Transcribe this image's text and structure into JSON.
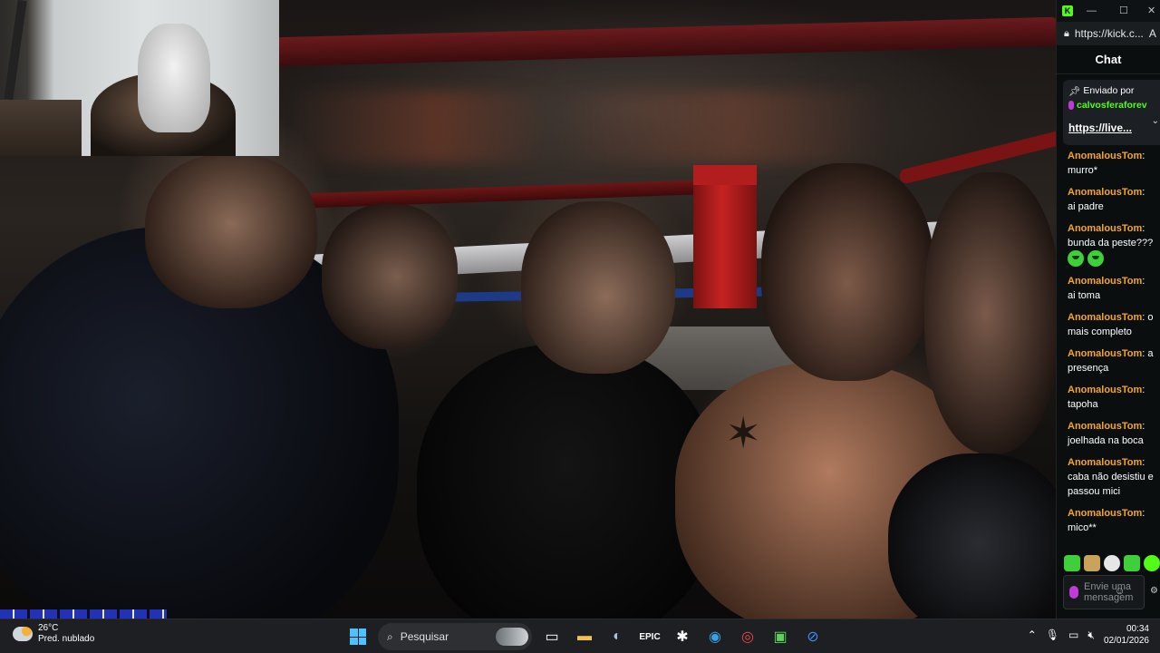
{
  "browser": {
    "url": "https://kick.c...",
    "url_suffix": "A"
  },
  "chat": {
    "title": "Chat",
    "pinned": {
      "label": "Enviado por",
      "user": "calvosferaforev",
      "link": "https://live..."
    },
    "messages": [
      {
        "user": "AnomalousTom",
        "text": "murro*"
      },
      {
        "user": "AnomalousTom",
        "text": "ai padre"
      },
      {
        "user": "AnomalousTom",
        "text": "bunda da peste???"
      },
      {
        "user": "AnomalousTom",
        "text": "ai toma"
      },
      {
        "user": "AnomalousTom",
        "text": "o mais completo"
      },
      {
        "user": "AnomalousTom",
        "text": "a presença"
      },
      {
        "user": "AnomalousTom",
        "text": "tapoha"
      },
      {
        "user": "AnomalousTom",
        "text": "joelhada na boca"
      },
      {
        "user": "AnomalousTom",
        "text": "caba não desistiu e passou mici"
      },
      {
        "user": "AnomalousTom",
        "text": "mico**"
      }
    ],
    "input_placeholder": "Envie uma mensagem"
  },
  "taskbar": {
    "weather_temp": "26°C",
    "weather_desc": "Pred. nublado",
    "search_label": "Pesquisar",
    "time": "00:34",
    "date": "02/01/2026"
  },
  "colors": {
    "kick_green": "#53fc18",
    "username": "#f5a623",
    "taskbar_bg": "#1d1f22"
  }
}
